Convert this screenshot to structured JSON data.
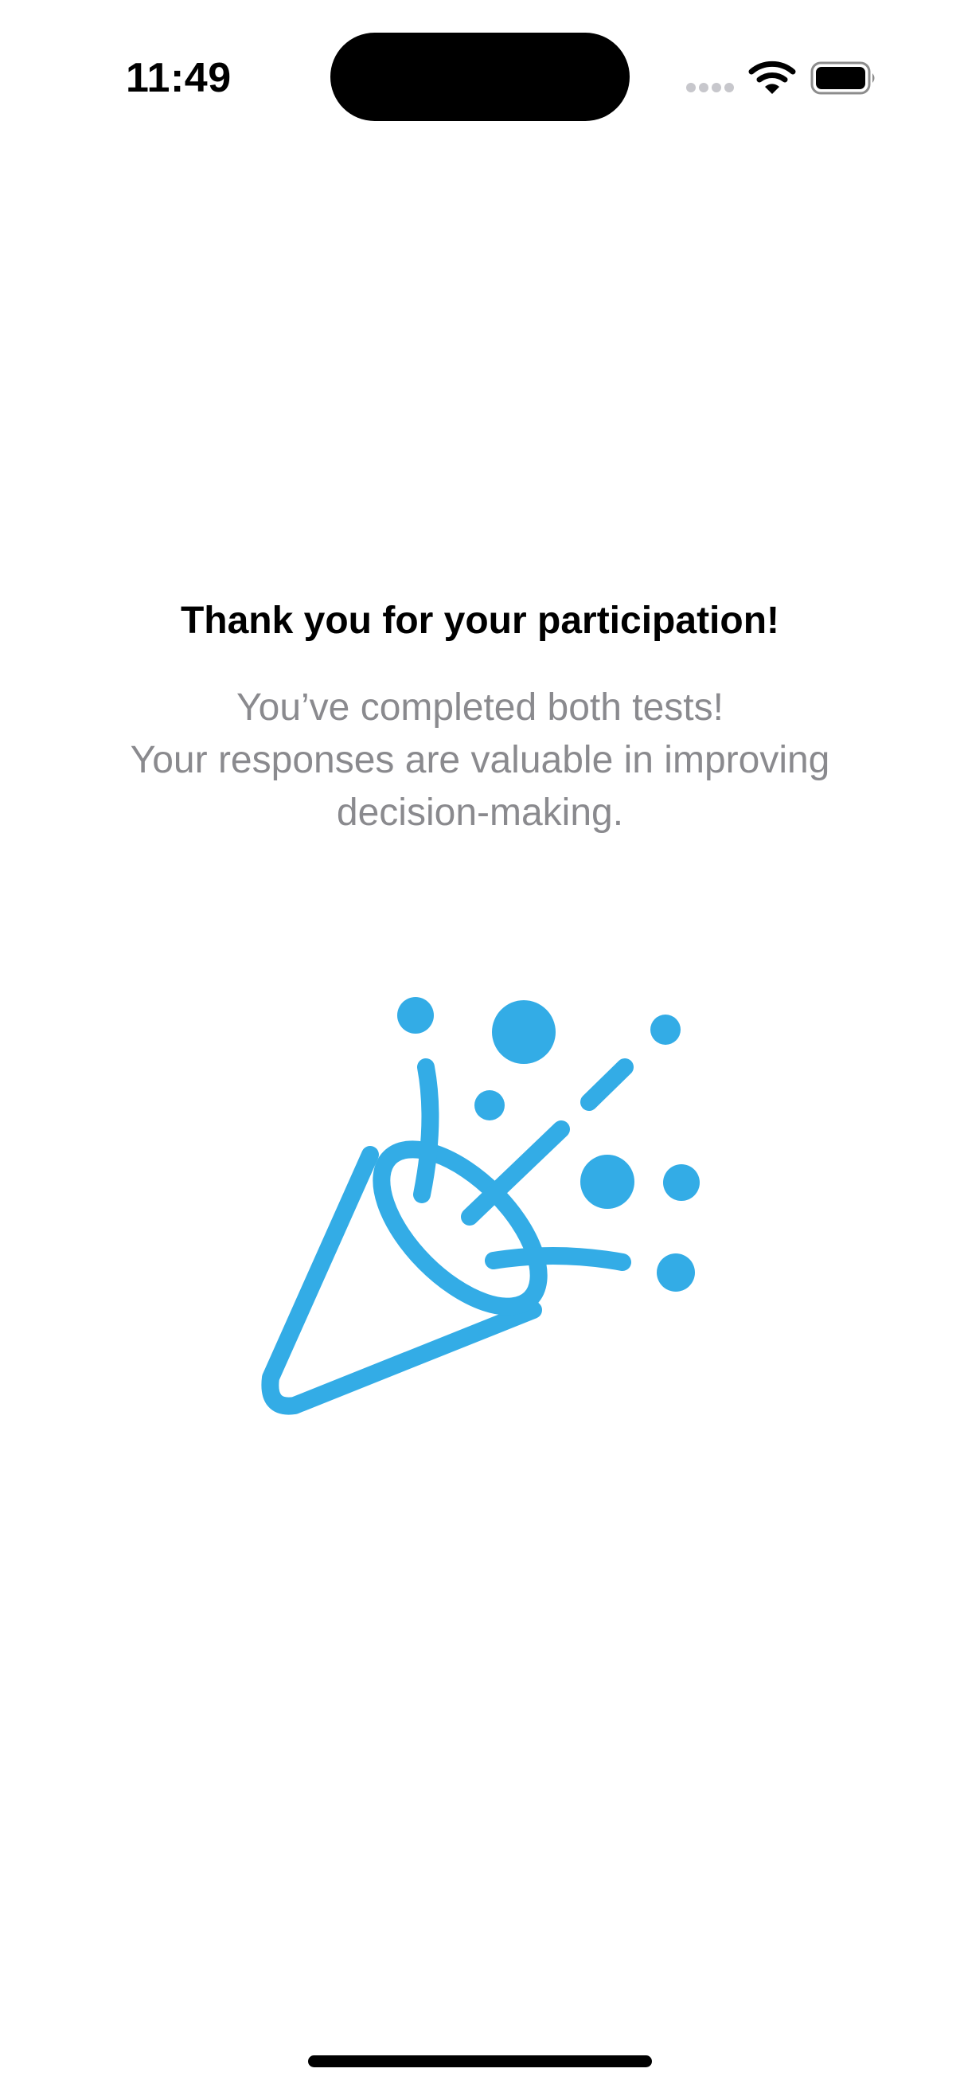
{
  "status_bar": {
    "time": "11:49",
    "signal_icon": "cellular-dots-icon",
    "wifi_icon": "wifi-icon",
    "battery_icon": "battery-icon"
  },
  "main": {
    "title": "Thank you for your participation!",
    "subtitle_lines": [
      "You’ve completed both tests!",
      "Your responses are valuable in improving",
      "decision-making."
    ],
    "illustration_icon": "party-popper-icon"
  },
  "colors": {
    "accent": "#33ace6",
    "secondary_text": "#8a8a8e",
    "primary_text": "#000000"
  }
}
